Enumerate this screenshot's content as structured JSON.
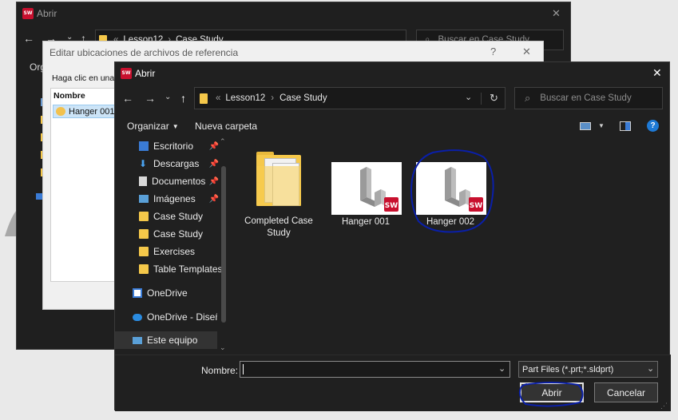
{
  "back_dialog": {
    "title": "Abrir",
    "close_glyph": "✕",
    "breadcrumb": [
      "Lesson12",
      "Case Study"
    ],
    "search_placeholder": "Buscar en Case Study",
    "toolbar_fragment": "Org"
  },
  "ref_dialog": {
    "title": "Editar ubicaciones de archivos de referencia",
    "help_glyph": "?",
    "close_glyph": "✕",
    "hint": "Haga clic en una c",
    "column_header": "Nombre",
    "item": "Hanger 001."
  },
  "main_dialog": {
    "title": "Abrir",
    "close_glyph": "✕",
    "address": {
      "chevrons": "«",
      "path": [
        "Lesson12",
        "Case Study"
      ]
    },
    "search_placeholder": "Buscar en Case Study",
    "toolbar": {
      "organize": "Organizar",
      "new_folder": "Nueva carpeta"
    },
    "sidebar": [
      {
        "label": "Escritorio",
        "icon": "desktop-icon",
        "pinned": true
      },
      {
        "label": "Descargas",
        "icon": "download-icon",
        "pinned": true
      },
      {
        "label": "Documentos",
        "icon": "document-icon",
        "pinned": true
      },
      {
        "label": "Imágenes",
        "icon": "pictures-icon",
        "pinned": true
      },
      {
        "label": "Case Study",
        "icon": "folder-icon",
        "pinned": false
      },
      {
        "label": "Case Study",
        "icon": "folder-icon",
        "pinned": false
      },
      {
        "label": "Exercises",
        "icon": "folder-icon",
        "pinned": false
      },
      {
        "label": "Table Templates",
        "icon": "folder-icon",
        "pinned": false
      },
      {
        "label": "OneDrive",
        "icon": "onedrive-icon",
        "pinned": false
      },
      {
        "label": "OneDrive - Diseño",
        "icon": "cloud-icon",
        "pinned": false
      },
      {
        "label": "Este equipo",
        "icon": "computer-icon",
        "pinned": false
      }
    ],
    "files": [
      {
        "name_line1": "Completed Case",
        "name_line2": "Study",
        "type": "folder"
      },
      {
        "name_line1": "Hanger 001",
        "name_line2": "",
        "type": "part"
      },
      {
        "name_line1": "Hanger 002",
        "name_line2": "",
        "type": "part"
      }
    ],
    "filename_label": "Nombre:",
    "filename_value": "",
    "filter_value": "Part Files (*.prt;*.sldprt)",
    "open_button": "Abrir",
    "cancel_button": "Cancelar"
  },
  "colors": {
    "dark_bg": "#202020",
    "accent_blue": "#0a1fa8",
    "folder_yellow": "#f5c84a",
    "sw_red": "#c8102e",
    "help_blue": "#1e7ad6"
  }
}
